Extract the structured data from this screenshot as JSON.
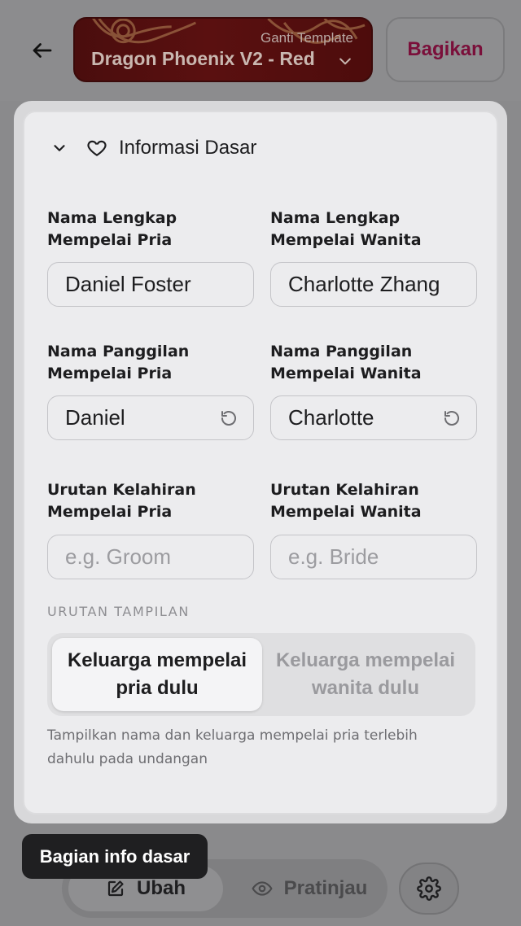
{
  "header": {
    "back_icon": "arrow-left-icon",
    "template_label": "Ganti Template",
    "template_name": "Dragon Phoenix V2 - Red",
    "share_label": "Bagikan",
    "share_color": "#7a0f3a"
  },
  "section": {
    "title": "Informasi Dasar",
    "icon": "heart-icon",
    "collapse_icon": "chevron-down-icon"
  },
  "fields": {
    "groom_full_name": {
      "label": "Nama Lengkap Mempelai Pria",
      "value": "Daniel Foster"
    },
    "bride_full_name": {
      "label": "Nama Lengkap Mempelai Wanita",
      "value": "Charlotte Zhang"
    },
    "groom_nickname": {
      "label": "Nama Panggilan Mempelai Pria",
      "value": "Daniel"
    },
    "bride_nickname": {
      "label": "Nama Panggilan Mempelai Wanita",
      "value": "Charlotte"
    },
    "groom_birth_order": {
      "label": "Urutan Kelahiran Mempelai Pria",
      "placeholder": "e.g. Groom"
    },
    "bride_birth_order": {
      "label": "Urutan Kelahiran Mempelai Wanita",
      "placeholder": "e.g. Bride"
    }
  },
  "display_order": {
    "label": "URUTAN TAMPILAN",
    "options": [
      "Keluarga mempelai pria dulu",
      "Keluarga mempelai wanita dulu"
    ],
    "selected": "Keluarga mempelai pria dulu",
    "hint": "Tampilkan nama dan keluarga mempelai pria terlebih dahulu pada undangan"
  },
  "bottom_nav": {
    "edit_label": "Ubah",
    "preview_label": "Pratinjau",
    "edit_icon": "pencil-square-icon",
    "preview_icon": "eye-icon",
    "settings_icon": "gear-icon"
  },
  "tooltip": {
    "text": "Bagian info dasar"
  }
}
